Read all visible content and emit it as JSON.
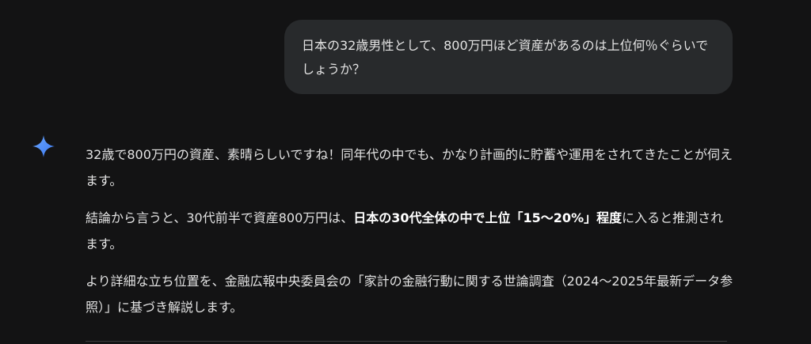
{
  "user_message": {
    "text": "日本の32歳男性として、800万円ほど資産があるのは上位何％ぐらいでしょうか？"
  },
  "assistant": {
    "icon": "gemini-spark-icon",
    "accent": "#4a8df8",
    "paragraphs": [
      {
        "text": "32歳で800万円の資産、素晴らしいですね！同年代の中でも、かなり計画的に貯蓄や運用をされてきたことが伺えます。"
      },
      {
        "before": "結論から言うと、30代前半で資産800万円は、",
        "bold": "日本の30代全体の中で上位「15〜20%」程度",
        "after": "に入ると推測されます。"
      },
      {
        "text": "より詳細な立ち位置を、金融広報中央委員会の「家計の金融行動に関する世論調査（2024〜2025年最新データ参照）」に基づき解説します。"
      }
    ]
  }
}
